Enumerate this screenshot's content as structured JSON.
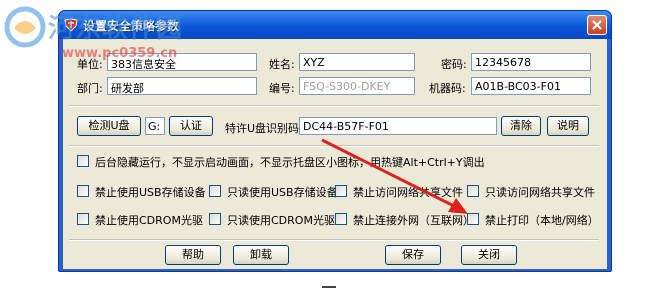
{
  "window": {
    "title": "设置安全策略参数"
  },
  "form": {
    "unit_label": "单位:",
    "unit_value": "383信息安全",
    "name_label": "姓名:",
    "name_value": "XYZ",
    "password_label": "密码:",
    "password_value": "12345678",
    "dept_label": "部门:",
    "dept_value": "研发部",
    "serial_label": "编号:",
    "serial_placeholder": "FSQ-S300-DKEY",
    "machine_label": "机器码:",
    "machine_value": "A01B-BC03-F01"
  },
  "usb_row": {
    "detect_button": "检测U盘",
    "drive_value": "G:",
    "auth_button": "认证",
    "special_label": "特许U盘识别码:",
    "special_value": "DC44-B57F-F01",
    "clear_button": "清除",
    "help_button": "说明"
  },
  "options": {
    "background_run": "后台隐藏运行，不显示启动画面，不显示托盘区小图标，用热键Alt+Ctrl+Y调出",
    "items": [
      "禁止使用USB存储设备",
      "只读使用USB存储设备",
      "禁止访问网络共享文件",
      "只读访问网络共享文件",
      "禁止使用CDROM光驱",
      "只读使用CDROM光驱",
      "禁止连接外网（互联网）",
      "禁止打印（本地/网络）"
    ]
  },
  "footer": {
    "help": "帮助",
    "uninstall": "卸载",
    "save": "保存",
    "close": "关闭"
  },
  "watermark": {
    "name": "河东软件园",
    "url": "www.pc0359.cn"
  },
  "colors": {
    "titlebar": "#0a56d8",
    "client": "#ece9d8",
    "arrow": "#e0201c"
  }
}
